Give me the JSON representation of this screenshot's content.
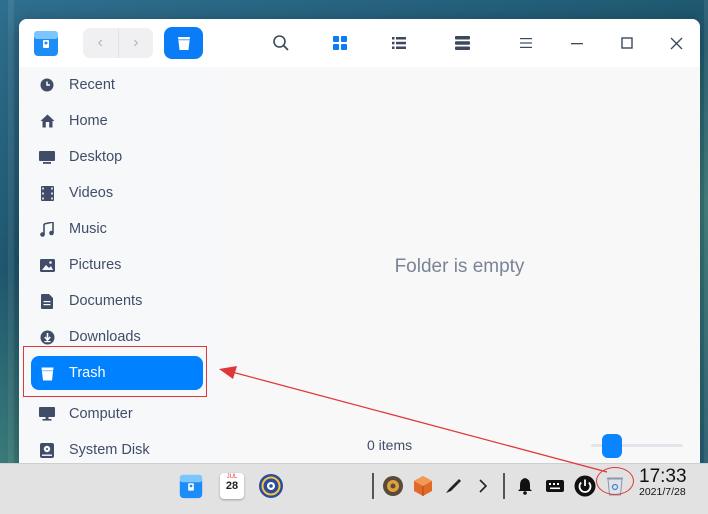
{
  "window": {
    "nav": {
      "back_icon": "chevron-left-icon",
      "forward_icon": "chevron-right-icon"
    },
    "breadcrumb_icon": "trash-icon",
    "toolbar": [
      "search-icon",
      "grid-view-icon",
      "list-view-icon",
      "detail-view-icon",
      "menu-icon",
      "minimize-icon",
      "maximize-icon",
      "close-icon"
    ]
  },
  "sidebar": {
    "items": [
      {
        "label": "Recent",
        "icon": "clock-icon"
      },
      {
        "label": "Home",
        "icon": "home-icon"
      },
      {
        "label": "Desktop",
        "icon": "desktop-icon"
      },
      {
        "label": "Videos",
        "icon": "film-icon"
      },
      {
        "label": "Music",
        "icon": "music-note-icon"
      },
      {
        "label": "Pictures",
        "icon": "picture-icon"
      },
      {
        "label": "Documents",
        "icon": "document-icon"
      },
      {
        "label": "Downloads",
        "icon": "download-icon"
      },
      {
        "label": "Trash",
        "icon": "trash-icon",
        "active": true
      },
      {
        "label": "Computer",
        "icon": "monitor-icon"
      },
      {
        "label": "System Disk",
        "icon": "disk-icon"
      }
    ]
  },
  "main": {
    "empty_message": "Folder is empty",
    "item_count": "0 items"
  },
  "taskbar": {
    "calendar_month": "JUL",
    "calendar_day": "28",
    "time": "17:33",
    "date": "2021/7/28"
  },
  "colors": {
    "accent": "#0081ff",
    "annotation": "#e0383a"
  }
}
